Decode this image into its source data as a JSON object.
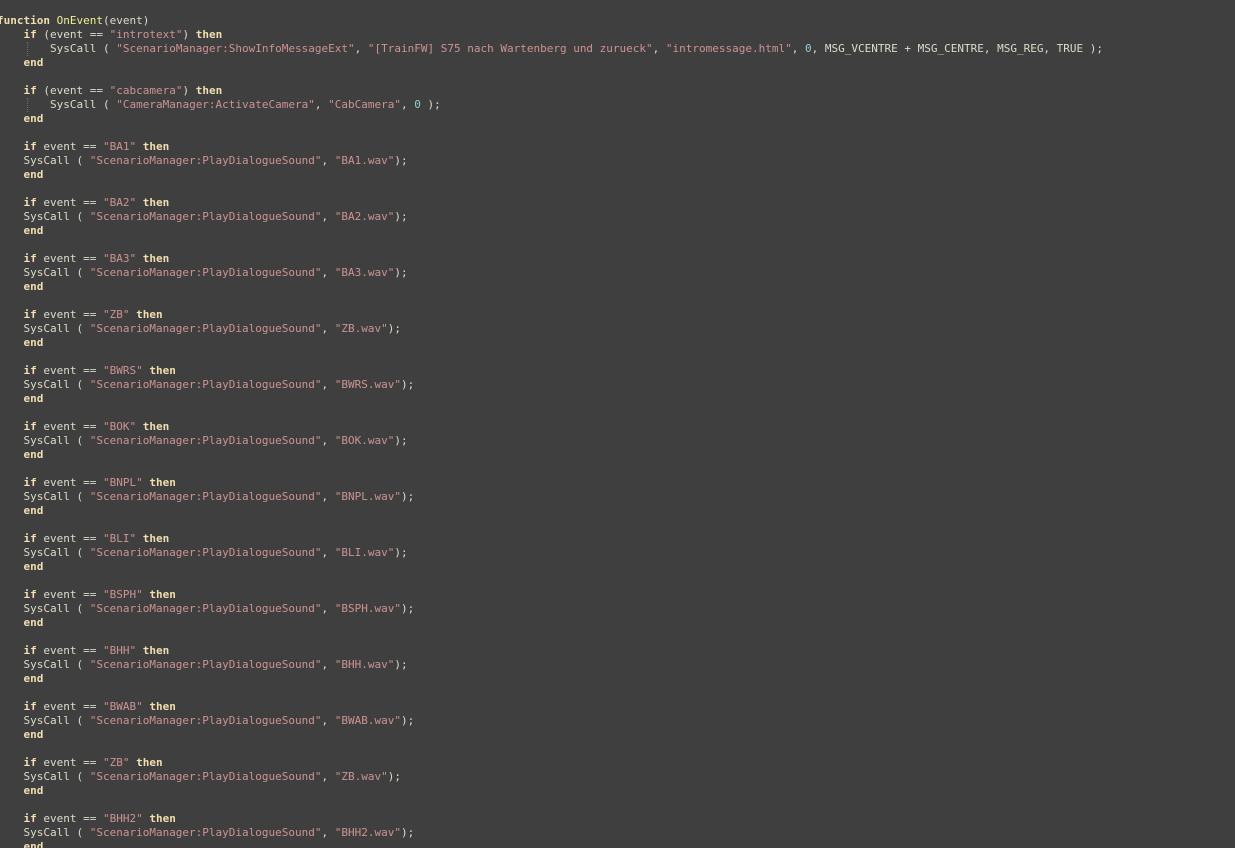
{
  "colors": {
    "background": "#3f3f3f",
    "text": "#dcdccc",
    "keyword": "#f0dfaf",
    "string": "#cc9393",
    "number": "#8cd0d3",
    "indent_guide": "#6a6a6a"
  },
  "code": {
    "lines": [
      [
        [
          "kw",
          "function"
        ],
        [
          "id",
          " "
        ],
        [
          "fn",
          "OnEvent"
        ],
        [
          "id",
          "(event)"
        ]
      ],
      [
        [
          "id",
          "    "
        ],
        [
          "kw",
          "if"
        ],
        [
          "id",
          " (event == "
        ],
        [
          "str",
          "\"introtext\""
        ],
        [
          "id",
          ") "
        ],
        [
          "kw",
          "then"
        ]
      ],
      [
        [
          "id",
          "        SysCall ( "
        ],
        [
          "str",
          "\"ScenarioManager:ShowInfoMessageExt\""
        ],
        [
          "id",
          ", "
        ],
        [
          "str",
          "\"[TrainFW] S75 nach Wartenberg und zurueck\""
        ],
        [
          "id",
          ", "
        ],
        [
          "str",
          "\"intromessage.html\""
        ],
        [
          "id",
          ", "
        ],
        [
          "num",
          "0"
        ],
        [
          "id",
          ", MSG_VCENTRE "
        ],
        [
          "op",
          "+"
        ],
        [
          "id",
          " MSG_CENTRE, MSG_REG, TRUE );"
        ]
      ],
      [
        [
          "id",
          "    "
        ],
        [
          "kw",
          "end"
        ]
      ],
      [
        [
          "id",
          ""
        ]
      ],
      [
        [
          "id",
          "    "
        ],
        [
          "kw",
          "if"
        ],
        [
          "id",
          " (event == "
        ],
        [
          "str",
          "\"cabcamera\""
        ],
        [
          "id",
          ") "
        ],
        [
          "kw",
          "then"
        ]
      ],
      [
        [
          "id",
          "        SysCall ( "
        ],
        [
          "str",
          "\"CameraManager:ActivateCamera\""
        ],
        [
          "id",
          ", "
        ],
        [
          "str",
          "\"CabCamera\""
        ],
        [
          "id",
          ", "
        ],
        [
          "num",
          "0"
        ],
        [
          "id",
          " );"
        ]
      ],
      [
        [
          "id",
          "    "
        ],
        [
          "kw",
          "end"
        ]
      ],
      [
        [
          "id",
          ""
        ]
      ],
      [
        [
          "id",
          "    "
        ],
        [
          "kw",
          "if"
        ],
        [
          "id",
          " event == "
        ],
        [
          "str",
          "\"BA1\""
        ],
        [
          "id",
          " "
        ],
        [
          "kw",
          "then"
        ]
      ],
      [
        [
          "id",
          "    SysCall ( "
        ],
        [
          "str",
          "\"ScenarioManager:PlayDialogueSound\""
        ],
        [
          "id",
          ", "
        ],
        [
          "str",
          "\"BA1.wav\""
        ],
        [
          "id",
          ");"
        ]
      ],
      [
        [
          "id",
          "    "
        ],
        [
          "kw",
          "end"
        ]
      ],
      [
        [
          "id",
          ""
        ]
      ],
      [
        [
          "id",
          "    "
        ],
        [
          "kw",
          "if"
        ],
        [
          "id",
          " event == "
        ],
        [
          "str",
          "\"BA2\""
        ],
        [
          "id",
          " "
        ],
        [
          "kw",
          "then"
        ]
      ],
      [
        [
          "id",
          "    SysCall ( "
        ],
        [
          "str",
          "\"ScenarioManager:PlayDialogueSound\""
        ],
        [
          "id",
          ", "
        ],
        [
          "str",
          "\"BA2.wav\""
        ],
        [
          "id",
          ");"
        ]
      ],
      [
        [
          "id",
          "    "
        ],
        [
          "kw",
          "end"
        ]
      ],
      [
        [
          "id",
          ""
        ]
      ],
      [
        [
          "id",
          "    "
        ],
        [
          "kw",
          "if"
        ],
        [
          "id",
          " event == "
        ],
        [
          "str",
          "\"BA3\""
        ],
        [
          "id",
          " "
        ],
        [
          "kw",
          "then"
        ]
      ],
      [
        [
          "id",
          "    SysCall ( "
        ],
        [
          "str",
          "\"ScenarioManager:PlayDialogueSound\""
        ],
        [
          "id",
          ", "
        ],
        [
          "str",
          "\"BA3.wav\""
        ],
        [
          "id",
          ");"
        ]
      ],
      [
        [
          "id",
          "    "
        ],
        [
          "kw",
          "end"
        ]
      ],
      [
        [
          "id",
          ""
        ]
      ],
      [
        [
          "id",
          "    "
        ],
        [
          "kw",
          "if"
        ],
        [
          "id",
          " event == "
        ],
        [
          "str",
          "\"ZB\""
        ],
        [
          "id",
          " "
        ],
        [
          "kw",
          "then"
        ]
      ],
      [
        [
          "id",
          "    SysCall ( "
        ],
        [
          "str",
          "\"ScenarioManager:PlayDialogueSound\""
        ],
        [
          "id",
          ", "
        ],
        [
          "str",
          "\"ZB.wav\""
        ],
        [
          "id",
          ");"
        ]
      ],
      [
        [
          "id",
          "    "
        ],
        [
          "kw",
          "end"
        ]
      ],
      [
        [
          "id",
          ""
        ]
      ],
      [
        [
          "id",
          "    "
        ],
        [
          "kw",
          "if"
        ],
        [
          "id",
          " event == "
        ],
        [
          "str",
          "\"BWRS\""
        ],
        [
          "id",
          " "
        ],
        [
          "kw",
          "then"
        ]
      ],
      [
        [
          "id",
          "    SysCall ( "
        ],
        [
          "str",
          "\"ScenarioManager:PlayDialogueSound\""
        ],
        [
          "id",
          ", "
        ],
        [
          "str",
          "\"BWRS.wav\""
        ],
        [
          "id",
          ");"
        ]
      ],
      [
        [
          "id",
          "    "
        ],
        [
          "kw",
          "end"
        ]
      ],
      [
        [
          "id",
          ""
        ]
      ],
      [
        [
          "id",
          "    "
        ],
        [
          "kw",
          "if"
        ],
        [
          "id",
          " event == "
        ],
        [
          "str",
          "\"BOK\""
        ],
        [
          "id",
          " "
        ],
        [
          "kw",
          "then"
        ]
      ],
      [
        [
          "id",
          "    SysCall ( "
        ],
        [
          "str",
          "\"ScenarioManager:PlayDialogueSound\""
        ],
        [
          "id",
          ", "
        ],
        [
          "str",
          "\"BOK.wav\""
        ],
        [
          "id",
          ");"
        ]
      ],
      [
        [
          "id",
          "    "
        ],
        [
          "kw",
          "end"
        ]
      ],
      [
        [
          "id",
          ""
        ]
      ],
      [
        [
          "id",
          "    "
        ],
        [
          "kw",
          "if"
        ],
        [
          "id",
          " event == "
        ],
        [
          "str",
          "\"BNPL\""
        ],
        [
          "id",
          " "
        ],
        [
          "kw",
          "then"
        ]
      ],
      [
        [
          "id",
          "    SysCall ( "
        ],
        [
          "str",
          "\"ScenarioManager:PlayDialogueSound\""
        ],
        [
          "id",
          ", "
        ],
        [
          "str",
          "\"BNPL.wav\""
        ],
        [
          "id",
          ");"
        ]
      ],
      [
        [
          "id",
          "    "
        ],
        [
          "kw",
          "end"
        ]
      ],
      [
        [
          "id",
          ""
        ]
      ],
      [
        [
          "id",
          "    "
        ],
        [
          "kw",
          "if"
        ],
        [
          "id",
          " event == "
        ],
        [
          "str",
          "\"BLI\""
        ],
        [
          "id",
          " "
        ],
        [
          "kw",
          "then"
        ]
      ],
      [
        [
          "id",
          "    SysCall ( "
        ],
        [
          "str",
          "\"ScenarioManager:PlayDialogueSound\""
        ],
        [
          "id",
          ", "
        ],
        [
          "str",
          "\"BLI.wav\""
        ],
        [
          "id",
          ");"
        ]
      ],
      [
        [
          "id",
          "    "
        ],
        [
          "kw",
          "end"
        ]
      ],
      [
        [
          "id",
          ""
        ]
      ],
      [
        [
          "id",
          "    "
        ],
        [
          "kw",
          "if"
        ],
        [
          "id",
          " event == "
        ],
        [
          "str",
          "\"BSPH\""
        ],
        [
          "id",
          " "
        ],
        [
          "kw",
          "then"
        ]
      ],
      [
        [
          "id",
          "    SysCall ( "
        ],
        [
          "str",
          "\"ScenarioManager:PlayDialogueSound\""
        ],
        [
          "id",
          ", "
        ],
        [
          "str",
          "\"BSPH.wav\""
        ],
        [
          "id",
          ");"
        ]
      ],
      [
        [
          "id",
          "    "
        ],
        [
          "kw",
          "end"
        ]
      ],
      [
        [
          "id",
          ""
        ]
      ],
      [
        [
          "id",
          "    "
        ],
        [
          "kw",
          "if"
        ],
        [
          "id",
          " event == "
        ],
        [
          "str",
          "\"BHH\""
        ],
        [
          "id",
          " "
        ],
        [
          "kw",
          "then"
        ]
      ],
      [
        [
          "id",
          "    SysCall ( "
        ],
        [
          "str",
          "\"ScenarioManager:PlayDialogueSound\""
        ],
        [
          "id",
          ", "
        ],
        [
          "str",
          "\"BHH.wav\""
        ],
        [
          "id",
          ");"
        ]
      ],
      [
        [
          "id",
          "    "
        ],
        [
          "kw",
          "end"
        ]
      ],
      [
        [
          "id",
          ""
        ]
      ],
      [
        [
          "id",
          "    "
        ],
        [
          "kw",
          "if"
        ],
        [
          "id",
          " event == "
        ],
        [
          "str",
          "\"BWAB\""
        ],
        [
          "id",
          " "
        ],
        [
          "kw",
          "then"
        ]
      ],
      [
        [
          "id",
          "    SysCall ( "
        ],
        [
          "str",
          "\"ScenarioManager:PlayDialogueSound\""
        ],
        [
          "id",
          ", "
        ],
        [
          "str",
          "\"BWAB.wav\""
        ],
        [
          "id",
          ");"
        ]
      ],
      [
        [
          "id",
          "    "
        ],
        [
          "kw",
          "end"
        ]
      ],
      [
        [
          "id",
          ""
        ]
      ],
      [
        [
          "id",
          "    "
        ],
        [
          "kw",
          "if"
        ],
        [
          "id",
          " event == "
        ],
        [
          "str",
          "\"ZB\""
        ],
        [
          "id",
          " "
        ],
        [
          "kw",
          "then"
        ]
      ],
      [
        [
          "id",
          "    SysCall ( "
        ],
        [
          "str",
          "\"ScenarioManager:PlayDialogueSound\""
        ],
        [
          "id",
          ", "
        ],
        [
          "str",
          "\"ZB.wav\""
        ],
        [
          "id",
          ");"
        ]
      ],
      [
        [
          "id",
          "    "
        ],
        [
          "kw",
          "end"
        ]
      ],
      [
        [
          "id",
          ""
        ]
      ],
      [
        [
          "id",
          "    "
        ],
        [
          "kw",
          "if"
        ],
        [
          "id",
          " event == "
        ],
        [
          "str",
          "\"BHH2\""
        ],
        [
          "id",
          " "
        ],
        [
          "kw",
          "then"
        ]
      ],
      [
        [
          "id",
          "    SysCall ( "
        ],
        [
          "str",
          "\"ScenarioManager:PlayDialogueSound\""
        ],
        [
          "id",
          ", "
        ],
        [
          "str",
          "\"BHH2.wav\""
        ],
        [
          "id",
          ");"
        ]
      ],
      [
        [
          "id",
          "    "
        ],
        [
          "kw",
          "end"
        ]
      ]
    ]
  }
}
